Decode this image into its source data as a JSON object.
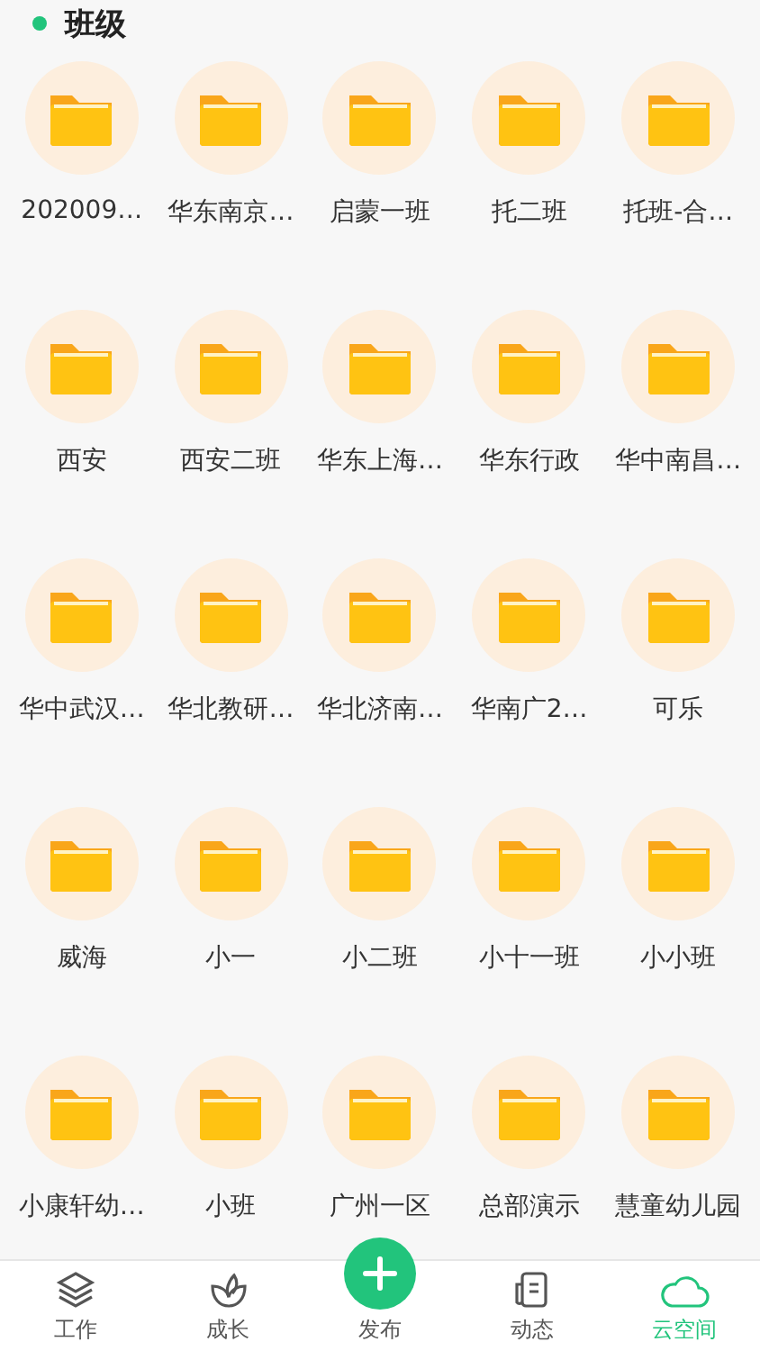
{
  "section": {
    "title": "班级"
  },
  "folders": [
    {
      "name": "202009…"
    },
    {
      "name": "华东南京…"
    },
    {
      "name": "启蒙一班"
    },
    {
      "name": "托二班"
    },
    {
      "name": "托班-合…"
    },
    {
      "name": "西安"
    },
    {
      "name": "西安二班"
    },
    {
      "name": "华东上海…"
    },
    {
      "name": "华东行政"
    },
    {
      "name": "华中南昌…"
    },
    {
      "name": "华中武汉…"
    },
    {
      "name": "华北教研…"
    },
    {
      "name": "华北济南…"
    },
    {
      "name": "华南广2…"
    },
    {
      "name": "可乐"
    },
    {
      "name": "威海"
    },
    {
      "name": "小一"
    },
    {
      "name": "小二班"
    },
    {
      "name": "小十一班"
    },
    {
      "name": "小小班"
    },
    {
      "name": "小康轩幼…"
    },
    {
      "name": "小班"
    },
    {
      "name": "广州一区"
    },
    {
      "name": "总部演示"
    },
    {
      "name": "慧童幼儿园"
    }
  ],
  "tab_bar": [
    {
      "kind": "work",
      "label": "工作",
      "selected": false
    },
    {
      "kind": "growth",
      "label": "成长",
      "selected": false
    },
    {
      "kind": "publish",
      "label": "发布",
      "selected": false
    },
    {
      "kind": "moments",
      "label": "动态",
      "selected": false
    },
    {
      "kind": "cloud",
      "label": "云空间",
      "selected": true
    }
  ]
}
